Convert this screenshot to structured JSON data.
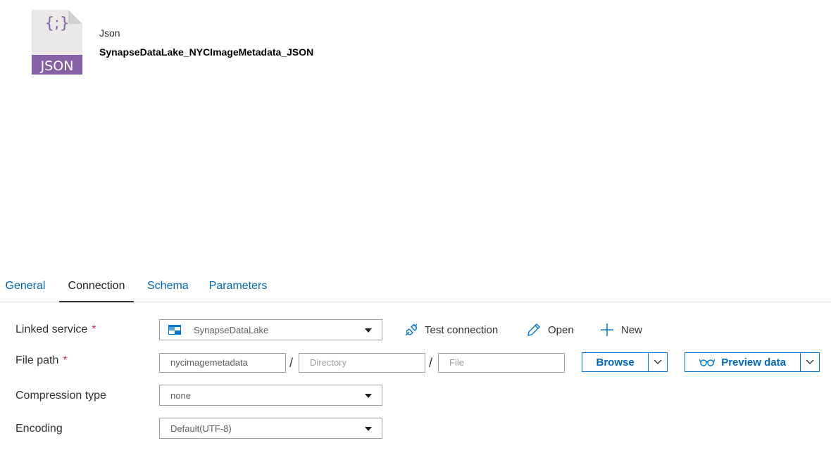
{
  "header": {
    "icon_text": "JSON",
    "icon_glyph": "{;}",
    "dataset_type": "Json",
    "dataset_name": "SynapseDataLake_NYCImageMetadata_JSON"
  },
  "tabs": [
    {
      "label": "General"
    },
    {
      "label": "Connection"
    },
    {
      "label": "Schema"
    },
    {
      "label": "Parameters"
    }
  ],
  "active_tab": "Connection",
  "form": {
    "linked_service": {
      "label": "Linked service",
      "required": "*",
      "value": "SynapseDataLake",
      "actions": {
        "test": "Test connection",
        "open": "Open",
        "new": "New"
      }
    },
    "file_path": {
      "label": "File path",
      "required": "*",
      "container_value": "nycimagemetadata",
      "directory_placeholder": "Directory",
      "file_placeholder": "File",
      "separator": "/",
      "browse_label": "Browse",
      "preview_label": "Preview data"
    },
    "compression_type": {
      "label": "Compression type",
      "value": "none"
    },
    "encoding": {
      "label": "Encoding",
      "value": "Default(UTF-8)"
    }
  },
  "colors": {
    "accent": "#0078d4",
    "link": "#0066b8",
    "json_icon": "#8661a6",
    "required": "#c4314b"
  }
}
